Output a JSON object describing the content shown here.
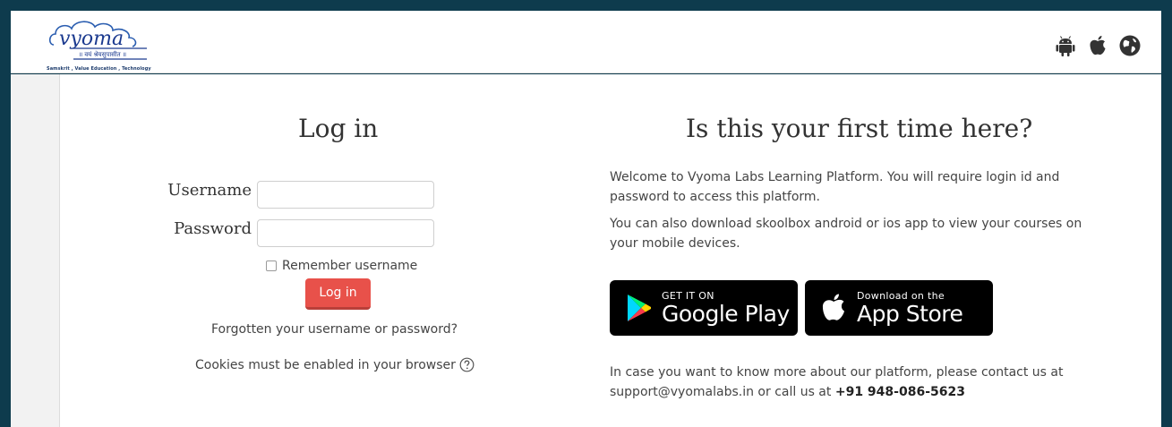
{
  "header": {
    "logo_text": "vyoma",
    "logo_subtitle": "॥ वयं श्रेयसुपासीत ॥",
    "logo_tagline": "Samskrit , Value Education , Technology",
    "icons": [
      "android-icon",
      "apple-icon",
      "globe-icon"
    ]
  },
  "login": {
    "title": "Log in",
    "username_label": "Username",
    "password_label": "Password",
    "username_value": "",
    "password_value": "",
    "remember_label": "Remember username",
    "submit_label": "Log in",
    "forgot_link": "Forgotten your username or password?",
    "cookies_note": "Cookies must be enabled in your browser"
  },
  "first_time": {
    "title": "Is this your first time here?",
    "para1": "Welcome to Vyoma Labs Learning Platform. You will require login id and password to access this platform.",
    "para2": "You can also download skoolbox android or ios app to view your courses on your mobile devices.",
    "google_play_small": "GET IT ON",
    "google_play_big": "Google Play",
    "app_store_small": "Download on the",
    "app_store_big": "App Store",
    "contact_text": "In case you want to know more about our platform, please contact us at support@vyomalabs.in or call us at",
    "contact_phone": "+91 948-086-5623"
  },
  "colors": {
    "background": "#0e3b4d",
    "login_button": "#e8514a",
    "logo_blue": "#1b3a8f"
  }
}
